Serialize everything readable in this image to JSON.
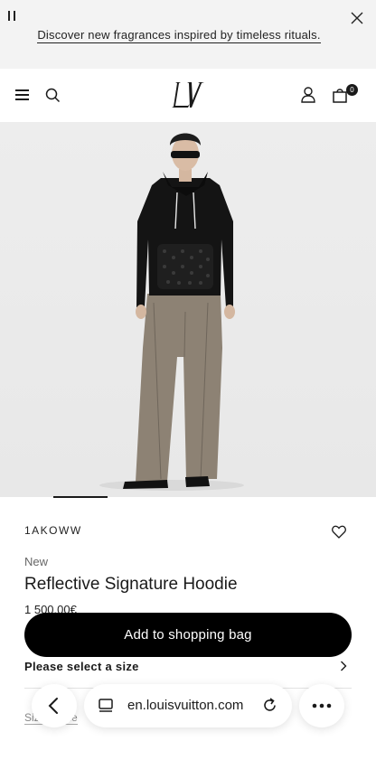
{
  "promo": {
    "text": "Discover new fragrances inspired by timeless rituals."
  },
  "header": {
    "logo": "LV",
    "bag_count": "0"
  },
  "product": {
    "sku": "1AKOWW",
    "badge": "New",
    "title": "Reflective Signature Hoodie",
    "price": "1 500,00€"
  },
  "actions": {
    "add_to_bag": "Add to shopping bag",
    "select_size": "Please select a size",
    "size_guide": "Size Guide"
  },
  "browser": {
    "url": "en.louisvuitton.com"
  },
  "colors": {
    "accent": "#000000",
    "promo_bg": "#f3f3f3",
    "hero_bg": "#ebebeb"
  },
  "icons": [
    "pause-icon",
    "close-icon",
    "hamburger-menu-icon",
    "search-icon",
    "lv-logo",
    "account-icon",
    "shopping-bag-icon",
    "heart-icon",
    "chevron-right-icon",
    "back-arrow-icon",
    "tabs-icon",
    "reload-icon",
    "more-icon"
  ]
}
